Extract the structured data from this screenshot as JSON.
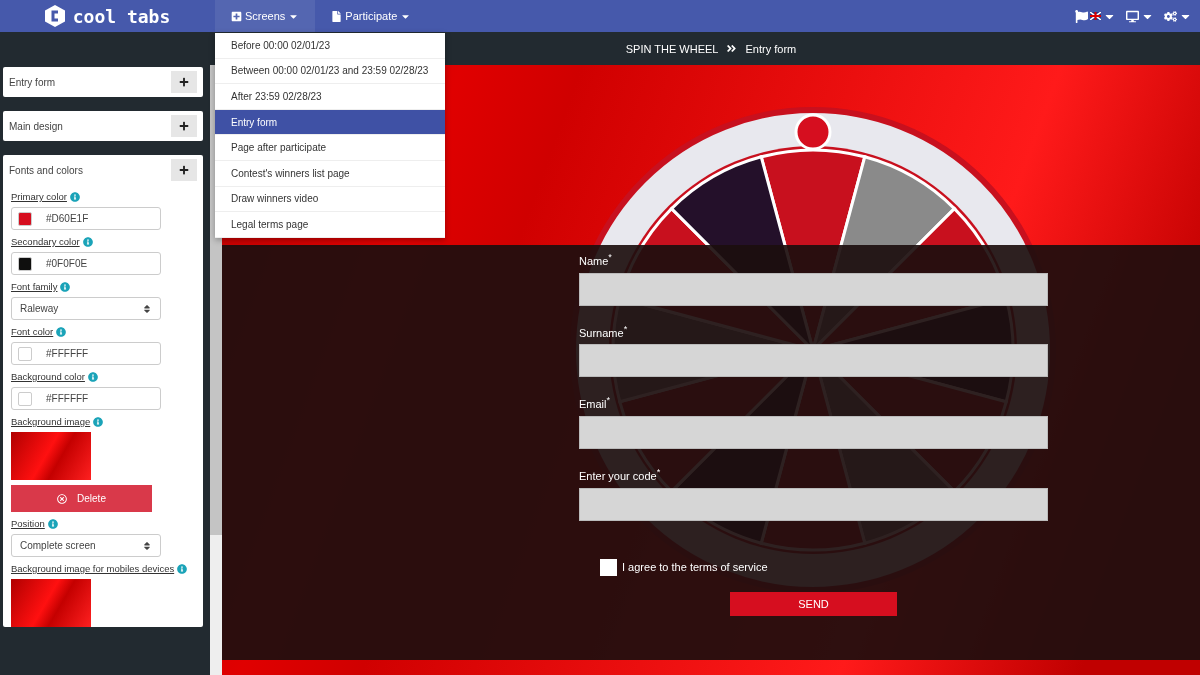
{
  "topbar": {
    "logo": "cool tabs",
    "menus": [
      {
        "kind": "screens",
        "label": "Screens",
        "expanded": true
      },
      {
        "kind": "participate",
        "label": "Participate",
        "expanded": false
      }
    ]
  },
  "screens_menu": [
    {
      "label": "Before 00:00 02/01/23",
      "selected": false
    },
    {
      "label": "Between 00:00 02/01/23 and 23:59 02/28/23",
      "selected": false
    },
    {
      "label": "After 23:59 02/28/23",
      "selected": false
    },
    {
      "label": "Entry form",
      "selected": true
    },
    {
      "label": "Page after participate",
      "selected": false
    },
    {
      "label": "Contest's winners list page",
      "selected": false
    },
    {
      "label": "Draw winners video",
      "selected": false
    },
    {
      "label": "Legal terms page",
      "selected": false
    }
  ],
  "breadcrumb": [
    "SPIN THE WHEEL",
    "Entry form"
  ],
  "sidebar": {
    "panels": [
      {
        "title": "Entry form"
      },
      {
        "title": "Main design"
      },
      {
        "title": "Fonts and colors",
        "settings": [
          {
            "kind": "color",
            "label": "Primary color",
            "value": "#D60E1F",
            "color": "#d60e1f"
          },
          {
            "kind": "color",
            "label": "Secondary color",
            "value": "#0F0F0E",
            "color": "#0f0f0e"
          },
          {
            "kind": "select",
            "label": "Font family",
            "value": "Raleway"
          },
          {
            "kind": "color",
            "label": "Font color",
            "value": "#FFFFFF",
            "color": "#ffffff"
          },
          {
            "kind": "color",
            "label": "Background color",
            "value": "#FFFFFF",
            "color": "#ffffff"
          },
          {
            "kind": "image",
            "label": "Background image",
            "button": "Delete"
          },
          {
            "kind": "select",
            "label": "Position",
            "value": "Complete screen"
          },
          {
            "kind": "image",
            "label": "Background image for mobiles devices"
          }
        ]
      }
    ]
  },
  "entry_form": {
    "fields": [
      {
        "label": "Name$^{*}$"
      },
      {
        "label": "Surname$^{*}$"
      },
      {
        "label": "Email$^{*}$"
      },
      {
        "label": "Enter your code$^{*}$"
      }
    ],
    "terms": {
      "label": "I agree to the terms of service",
      "checked": false
    },
    "submit": "SEND"
  }
}
